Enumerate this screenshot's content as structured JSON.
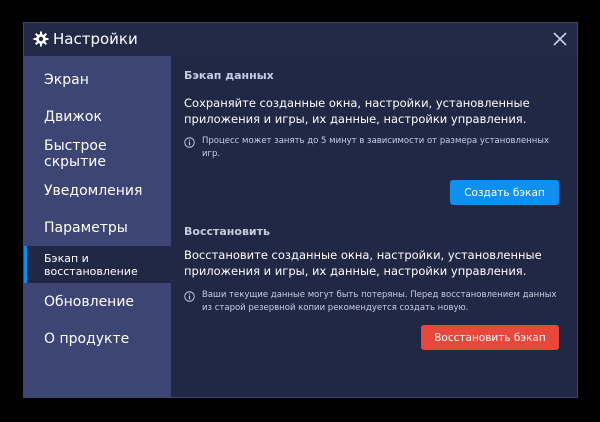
{
  "window": {
    "title": "Настройки"
  },
  "sidebar": {
    "items": [
      {
        "label": "Экран",
        "active": false
      },
      {
        "label": "Движок",
        "active": false
      },
      {
        "label": "Быстрое скрытие",
        "active": false
      },
      {
        "label": "Уведомления",
        "active": false
      },
      {
        "label": "Параметры",
        "active": false
      },
      {
        "label": "Бэкап и восстановление",
        "active": true
      },
      {
        "label": "Обновление",
        "active": false
      },
      {
        "label": "О продукте",
        "active": false
      }
    ]
  },
  "backup": {
    "title": "Бэкап данных",
    "description": "Сохраняйте созданные окна, настройки, установленные приложения и игры, их данные, настройки управления.",
    "note": "Процесс может занять до 5 минут в зависимости от размера установленных игр.",
    "button_label": "Создать бэкап"
  },
  "restore": {
    "title": "Восстановить",
    "description": "Восстановите созданные окна, настройки, установленные приложения и игры, их данные, настройки управления.",
    "note": "Ваши текущие данные могут быть потеряны. Перед восстановлением данных из старой резервной копии рекомендуется создать новую.",
    "button_label": "Восстановить бэкап"
  },
  "colors": {
    "window_bg": "#212845",
    "sidebar_bg": "#3c4573",
    "accent": "#0f8ff0",
    "danger": "#e8473c"
  },
  "icons": {
    "title": "gear-icon",
    "close": "close-icon",
    "note": "info-icon"
  }
}
